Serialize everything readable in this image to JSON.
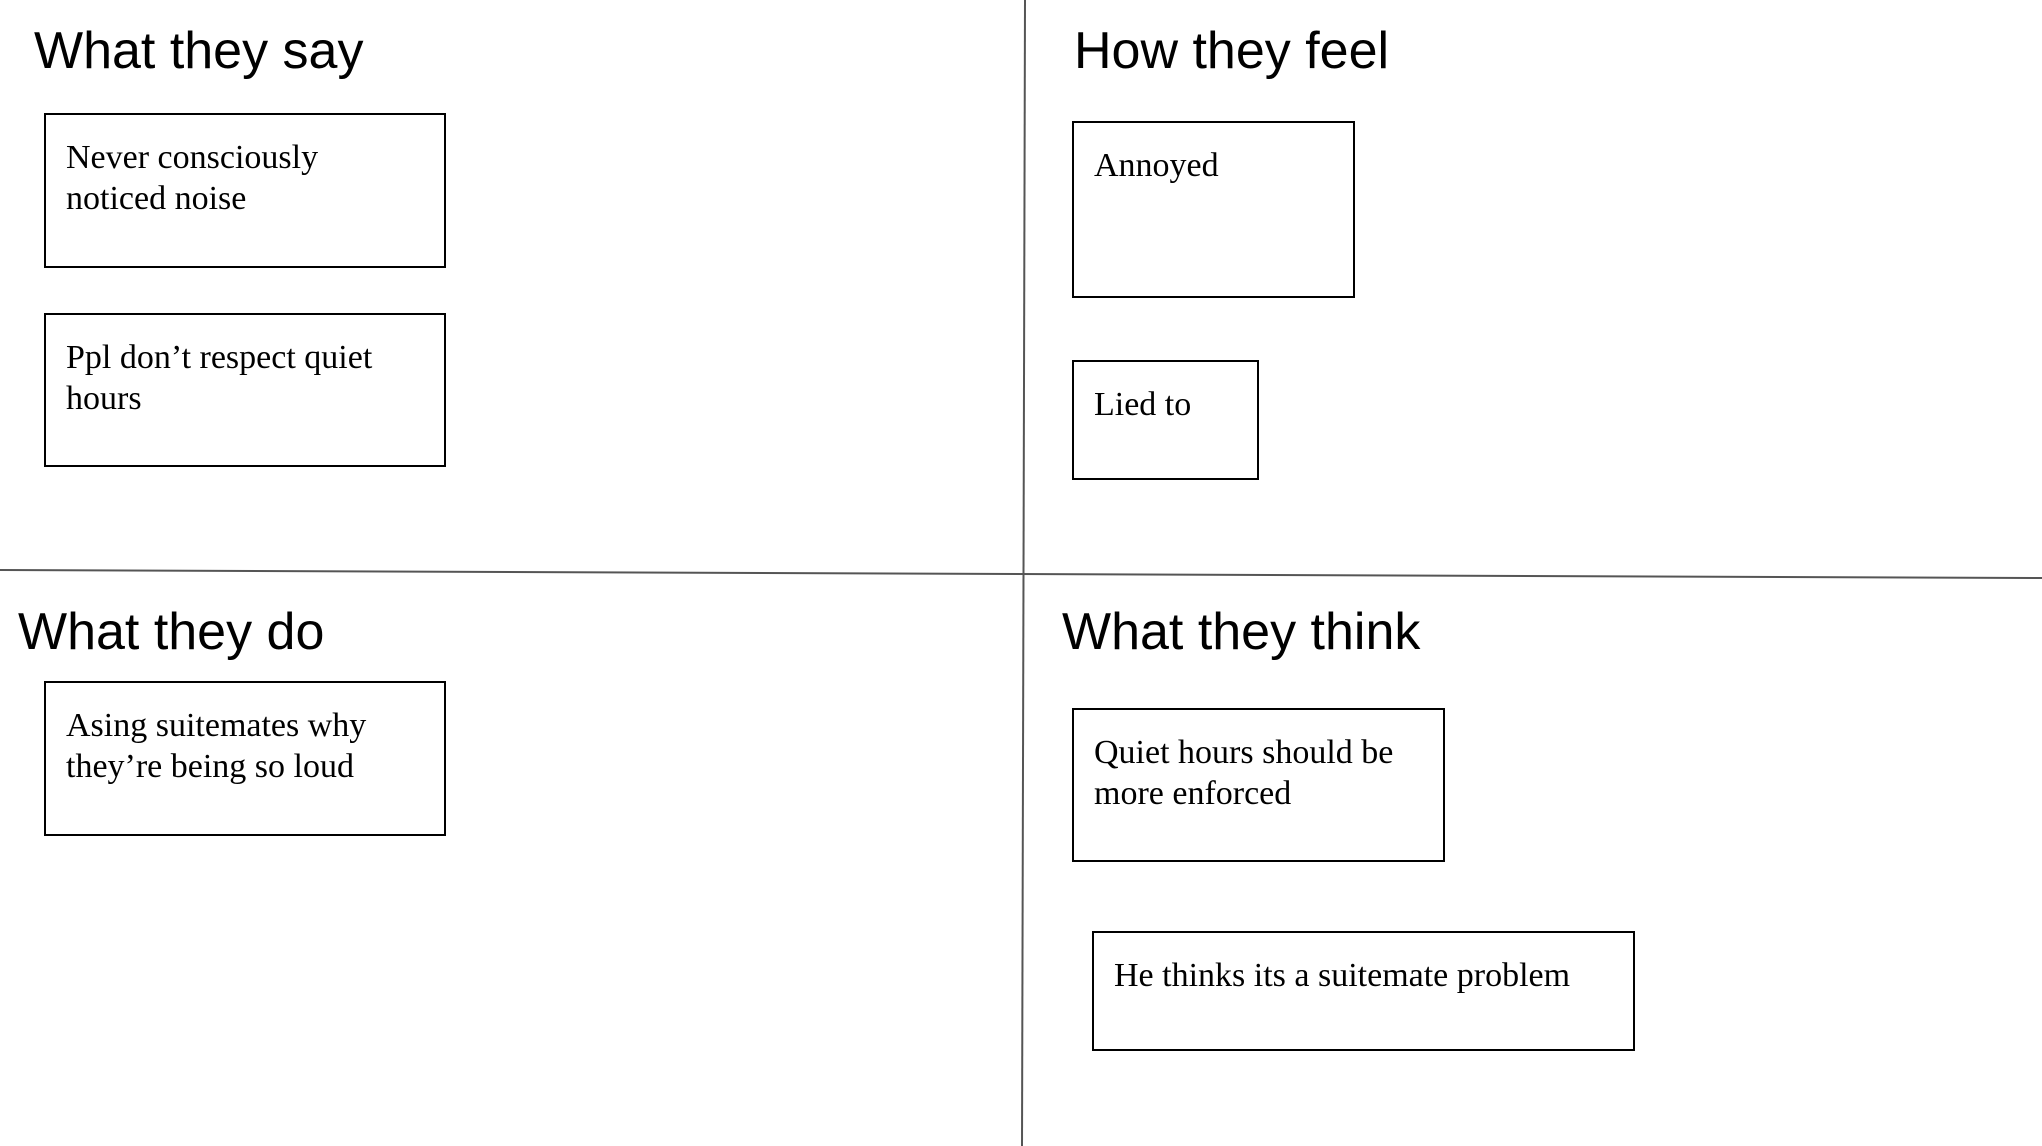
{
  "quadrants": {
    "say": {
      "title": "What they say",
      "notes": [
        "Never consciously noticed noise",
        "Ppl don’t respect quiet hours"
      ]
    },
    "feel": {
      "title": "How they feel",
      "notes": [
        "Annoyed",
        "Lied to"
      ]
    },
    "do": {
      "title": "What they do",
      "notes": [
        "Asing suitemates why they’re being so loud"
      ]
    },
    "think": {
      "title": "What they think",
      "notes": [
        "Quiet hours should be more enforced",
        "He thinks its a suitemate problem"
      ]
    }
  },
  "colors": {
    "background": "#ffffff",
    "ink": "#000000",
    "divider": "#555555"
  }
}
